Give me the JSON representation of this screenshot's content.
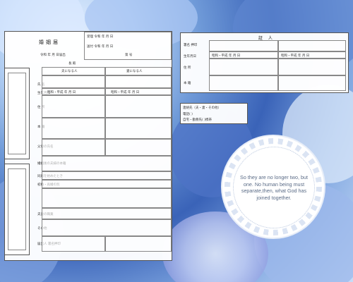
{
  "form": {
    "title": "婚姻届",
    "filing_date": "令和  年  月  日届出",
    "received": "受理 令和  年  月  日",
    "sent": "送付 令和  年  月  日",
    "number": "第     号",
    "addressee": "長 殿",
    "husband_label": "夫になる人",
    "wife_label": "妻になる人",
    "name_label": "氏 名",
    "birth_label": "生年月日",
    "address_label": "住 所",
    "honseki_label": "本 籍",
    "parents_label": "父母の氏名",
    "new_honseki_label": "婚姻後の夫婦の本籍",
    "cohabit_label": "同居を始めたとき",
    "previous_marriage_label": "初婚・再婚の別",
    "occupation_label": "夫妻の職業",
    "other_label": "その他",
    "signature_label": "届出人 署名押印",
    "reiwa_label": "昭和・平成 年 月 日"
  },
  "witness": {
    "title": "証 人",
    "signature_label": "署名 押印",
    "birth_label": "生年月日",
    "address_label": "住 所",
    "honseki_label": "本 籍",
    "birth_value": "昭和・平成 年 月 日"
  },
  "contact": {
    "title": "連絡先（夫・妻・その他）",
    "phone_label": "電話(   )",
    "home_label": "自宅・勤務先(  )携帯"
  },
  "quote": "So they are no longer two, but one. No human being must separate,then, what God has joined together."
}
